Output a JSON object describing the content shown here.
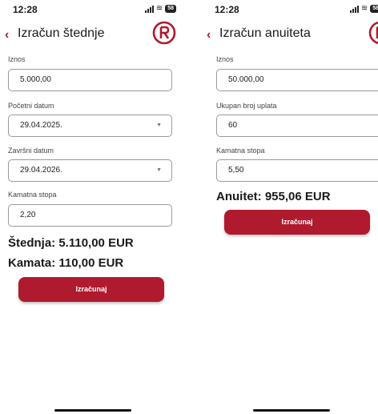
{
  "left": {
    "status": {
      "time": "12:28",
      "battery": "58"
    },
    "title": "Izračun štednje",
    "fields": [
      {
        "label": "Iznos",
        "value": "5.000,00"
      },
      {
        "label": "Početni datum",
        "value": "29.04.2025."
      },
      {
        "label": "Završni datum",
        "value": "29.04.2026."
      },
      {
        "label": "Kamatna stopa",
        "value": "2,20"
      }
    ],
    "results": [
      "Štednja: 5.110,00 EUR",
      "Kamata: 110,00 EUR"
    ],
    "button": "Izračunaj"
  },
  "right": {
    "status": {
      "time": "12:28",
      "battery": "58"
    },
    "title": "Izračun anuiteta",
    "fields": [
      {
        "label": "Iznos",
        "value": "50.000,00"
      },
      {
        "label": "Ukupan broj uplata",
        "value": "60"
      },
      {
        "label": "Kamatna stopa",
        "value": "5,50"
      }
    ],
    "results": [
      "Anuitet: 955,06 EUR"
    ],
    "button": "Izračunaj"
  },
  "colors": {
    "brand": "#b01a2e"
  },
  "icons": {
    "back": "chevron-left-icon",
    "logo": "r-logo-icon",
    "dropdown": "caret-down-icon"
  }
}
